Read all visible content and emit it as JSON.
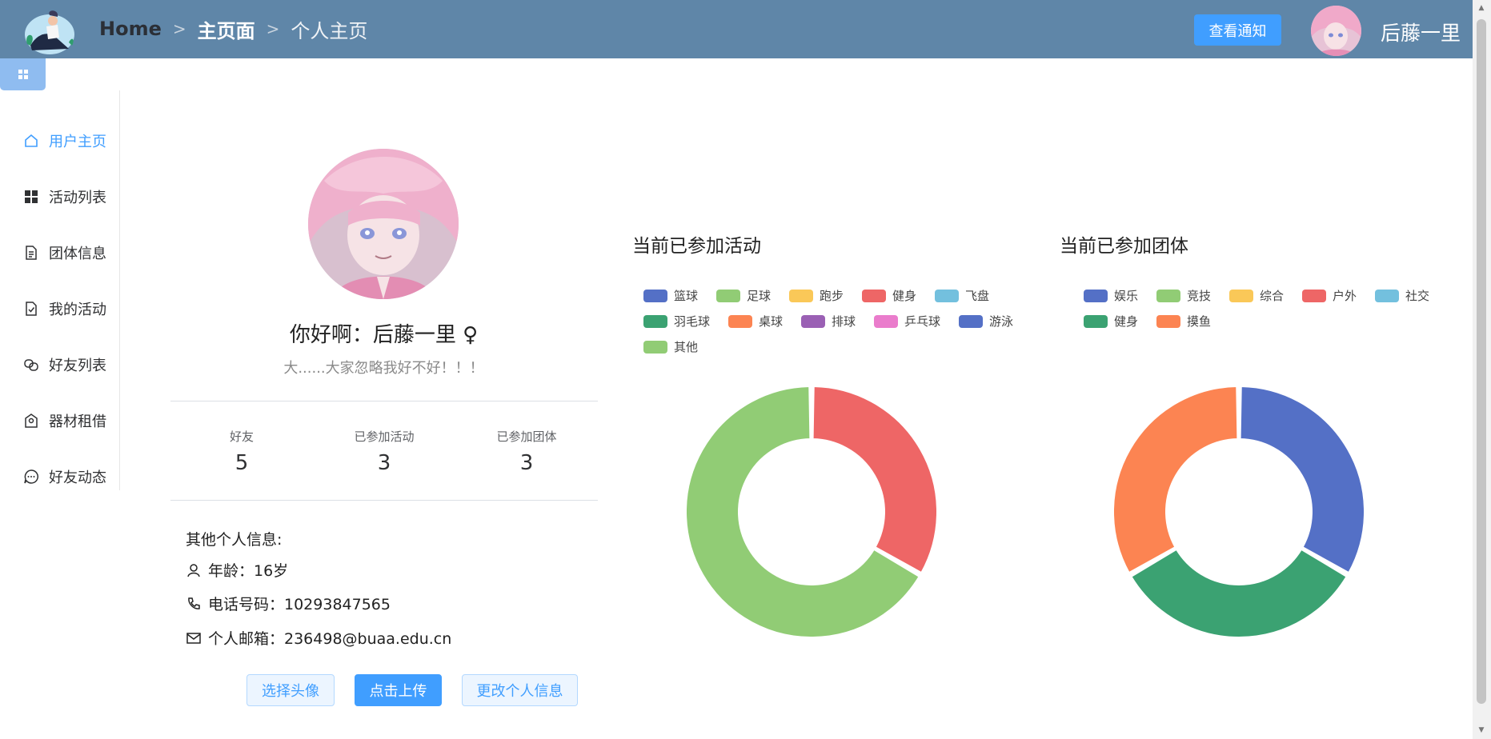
{
  "header": {
    "breadcrumb": [
      "Home",
      "主页面",
      "个人主页"
    ],
    "notify_label": "查看通知",
    "username": "后藤一里"
  },
  "sidebar": {
    "items": [
      {
        "label": "用户主页",
        "icon": "home-icon",
        "active": true
      },
      {
        "label": "活动列表",
        "icon": "grid-icon",
        "active": false
      },
      {
        "label": "团体信息",
        "icon": "document-icon",
        "active": false
      },
      {
        "label": "我的活动",
        "icon": "checked-document-icon",
        "active": false
      },
      {
        "label": "好友列表",
        "icon": "link-icon",
        "active": false
      },
      {
        "label": "器材租借",
        "icon": "location-icon",
        "active": false
      },
      {
        "label": "好友动态",
        "icon": "chat-icon",
        "active": false
      }
    ]
  },
  "profile": {
    "greeting": "你好啊：后藤一里 ♀",
    "motto": "大......大家忽略我好不好！！！",
    "stats": [
      {
        "label": "好友",
        "value": "5"
      },
      {
        "label": "已参加活动",
        "value": "3"
      },
      {
        "label": "已参加团体",
        "value": "3"
      }
    ],
    "info_title": "其他个人信息:",
    "age_label": "年龄：16岁",
    "phone_label": "电话号码：10293847565",
    "email_label": "个人邮箱：236498@buaa.edu.cn",
    "buttons": {
      "choose_avatar": "选择头像",
      "upload": "点击上传",
      "edit_info": "更改个人信息"
    }
  },
  "chart_data": [
    {
      "type": "pie",
      "title": "当前已参加活动",
      "legend": [
        "篮球",
        "足球",
        "跑步",
        "健身",
        "飞盘",
        "羽毛球",
        "桌球",
        "排球",
        "乒乓球",
        "游泳",
        "其他"
      ],
      "colors": [
        "#5470c6",
        "#91cc75",
        "#fac858",
        "#ee6666",
        "#73c0de",
        "#3ba272",
        "#fc8452",
        "#9a60b4",
        "#ea7ccc",
        "#5470c6",
        "#91cc75"
      ],
      "values": [
        0,
        0,
        0,
        1,
        0,
        0,
        0,
        0,
        0,
        0,
        2
      ],
      "legend_placement": "top"
    },
    {
      "type": "pie",
      "title": "当前已参加团体",
      "legend": [
        "娱乐",
        "竞技",
        "综合",
        "户外",
        "社交",
        "健身",
        "摸鱼"
      ],
      "colors": [
        "#5470c6",
        "#91cc75",
        "#fac858",
        "#ee6666",
        "#73c0de",
        "#3ba272",
        "#fc8452"
      ],
      "values": [
        1,
        0,
        0,
        0,
        0,
        1,
        1
      ],
      "legend_placement": "top"
    }
  ]
}
